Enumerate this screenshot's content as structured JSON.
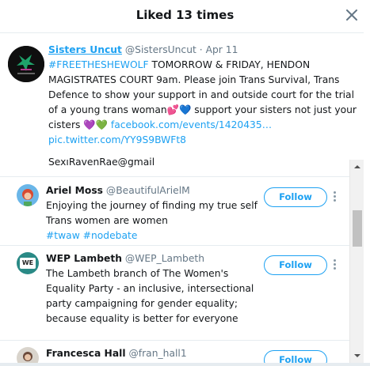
{
  "modal": {
    "title": "Liked 13 times"
  },
  "tweet": {
    "name": "Sisters Uncut",
    "handle": "@SistersUncut",
    "dot": "·",
    "date": "Apr 11",
    "hashtag": "#FREETHESHEWOLF",
    "text_1": " TOMORROW & FRIDAY, HENDON MAGISTRATES COURT 9am. Please join Trans Survival, Trans Defence to show your support in and outside court for the trial of a young trans woman",
    "heart_1": "💕",
    "heart_2": "💙",
    "text_2": " support your sisters not just your cisters ",
    "heart_3": "💜",
    "heart_4": "💚",
    "link_1": " facebook.com/events/1420435…",
    "link_2": "pic.twitter.com/YY9S9BWFt8",
    "footer_text": "SexıRavenRae@gmail"
  },
  "users": [
    {
      "name": "Ariel Moss",
      "handle": "@BeautifulArielM",
      "bio": "Enjoying the journey of finding my true self Trans women are women",
      "hashtags": "#twaw #nodebate",
      "follow_label": "Follow"
    },
    {
      "name": "WEP Lambeth",
      "handle": "@WEP_Lambeth",
      "bio": "The Lambeth branch of The Women's Equality Party - an inclusive, intersectional party campaigning for gender equality; because equality is better for everyone",
      "hashtags": "",
      "follow_label": "Follow",
      "avatar_text": "WE"
    },
    {
      "name": "Francesca Hall",
      "handle": "@fran_hall1",
      "bio": "",
      "hashtags": "",
      "follow_label": "Follow"
    }
  ],
  "colors": {
    "accent": "#1da1f2",
    "text": "#14171a",
    "muted": "#657786",
    "border": "#e6ecf0"
  },
  "icons": {
    "close": "close-icon",
    "more": "more-vertical-icon"
  }
}
